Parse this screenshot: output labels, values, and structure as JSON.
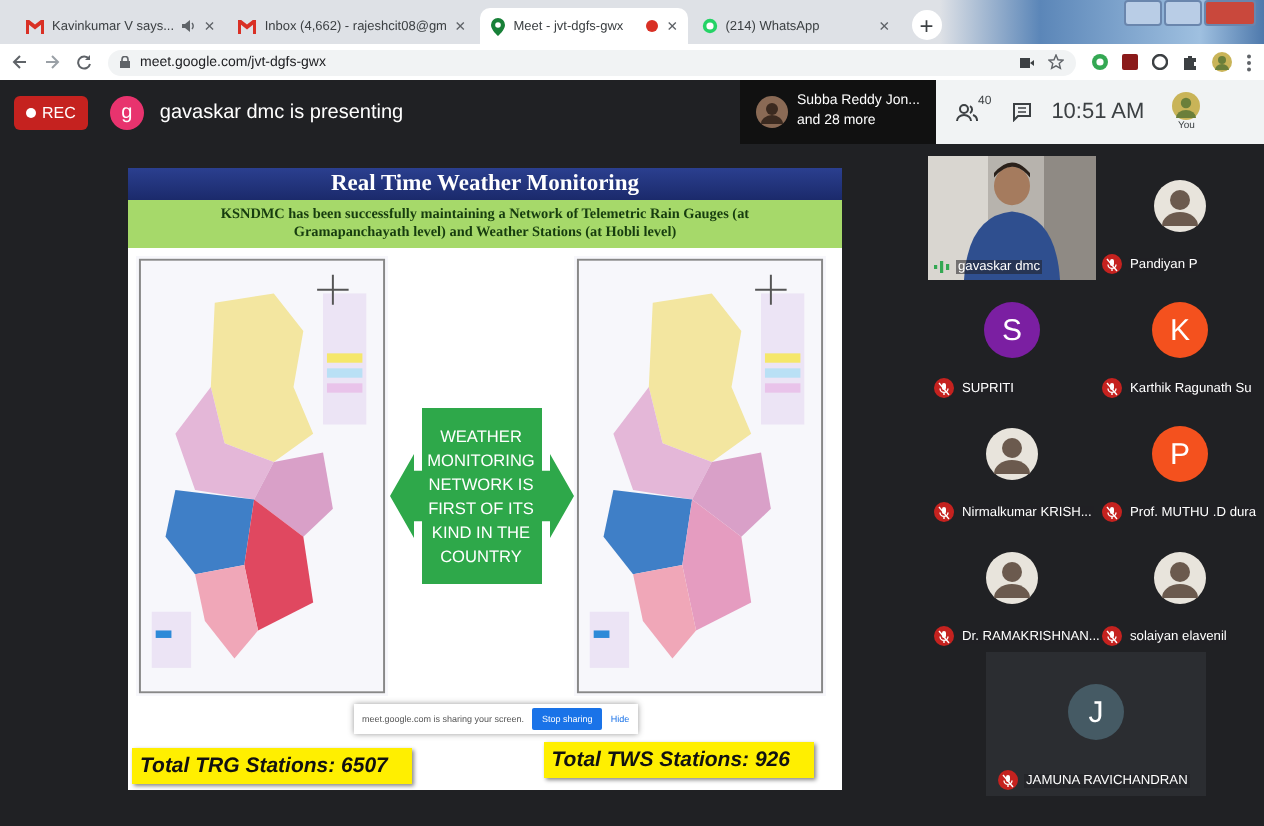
{
  "tabs": [
    {
      "title": "Kavinkumar V says...",
      "kind": "gmail",
      "playing_audio": true,
      "recording": false,
      "selected": false
    },
    {
      "title": "Inbox (4,662) - rajeshcit08@gm",
      "kind": "gmail",
      "playing_audio": false,
      "recording": false,
      "selected": false
    },
    {
      "title": "Meet - jvt-dgfs-gwx",
      "kind": "meet",
      "playing_audio": false,
      "recording": true,
      "selected": true
    },
    {
      "title": "(214) WhatsApp",
      "kind": "whatsapp",
      "playing_audio": false,
      "recording": false,
      "selected": false
    }
  ],
  "tab_close": "×",
  "new_tab": "+",
  "address_bar": {
    "url": "meet.google.com/jvt-dgfs-gwx"
  },
  "meet_bar": {
    "recording": "REC",
    "presenter_initial": "g",
    "presenting": "gavaskar dmc is presenting",
    "joined_name": "Subba Reddy Jon...",
    "joined_more": "and 28 more",
    "people_count": "40",
    "time": "10:51 AM",
    "self_label": "You"
  },
  "slide": {
    "title": "Real Time Weather Monitoring",
    "subtitle": "KSNDMC has been successfully maintaining a Network of Telemetric Rain Gauges (at Gramapanchayath level) and Weather Stations (at Hobli level)",
    "callout": "WEATHER MONITORING NETWORK IS FIRST OF ITS KIND IN THE COUNTRY",
    "totals": [
      "Total TRG Stations: 6507",
      "Total TWS Stations: 926"
    ],
    "share_notice": {
      "message": "meet.google.com is sharing your screen.",
      "stop": "Stop sharing",
      "hide": "Hide"
    }
  },
  "participants": [
    {
      "name": "gavaskar dmc",
      "kind": "video",
      "muted": false
    },
    {
      "name": "Pandiyan P",
      "muted": true
    },
    {
      "name": "SUPRITI",
      "kind": "initial",
      "initial": "S",
      "color": "#7b1fa2",
      "muted": true
    },
    {
      "name": "Karthik Ragunath Su",
      "kind": "initial",
      "initial": "K",
      "color": "#f4511e",
      "muted": true
    },
    {
      "name": "Nirmalkumar KRISH...",
      "muted": true
    },
    {
      "name": "Prof. MUTHU .D dura",
      "kind": "initial",
      "initial": "P",
      "color": "#f4511e",
      "muted": true
    },
    {
      "name": "Dr. RAMAKRISHNAN...",
      "muted": true
    },
    {
      "name": "solaiyan elavenil",
      "muted": true
    },
    {
      "name": "JAMUNA RAVICHANDRAN",
      "kind": "initial",
      "initial": "J",
      "color": "#455a64",
      "muted": true
    }
  ]
}
